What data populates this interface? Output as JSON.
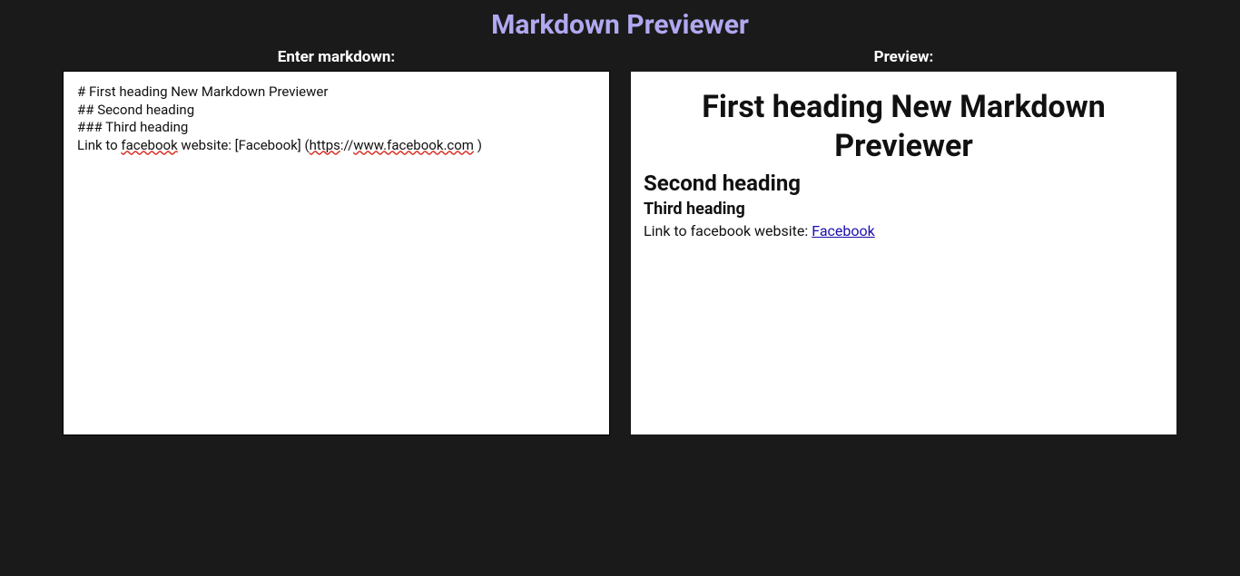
{
  "title": "Markdown Previewer",
  "editor": {
    "label": "Enter markdown:",
    "lines": {
      "l1": "# First heading New Markdown Previewer",
      "l2": "## Second heading",
      "l3a": "### ",
      "l3b": "Third heading",
      "l4a": "Link to ",
      "l4b": "facebook",
      "l4c": " website: [Facebook] (",
      "l4d": "https",
      "l4e": "://",
      "l4f": "www.facebook.com",
      "l4g": " )"
    }
  },
  "preview": {
    "label": "Preview:",
    "h1": "First heading New Markdown Previewer",
    "h2": "Second heading",
    "h3": "Third heading",
    "p_before": "Link to facebook website: ",
    "link_text": "Facebook",
    "link_href": "https://www.facebook.com"
  }
}
